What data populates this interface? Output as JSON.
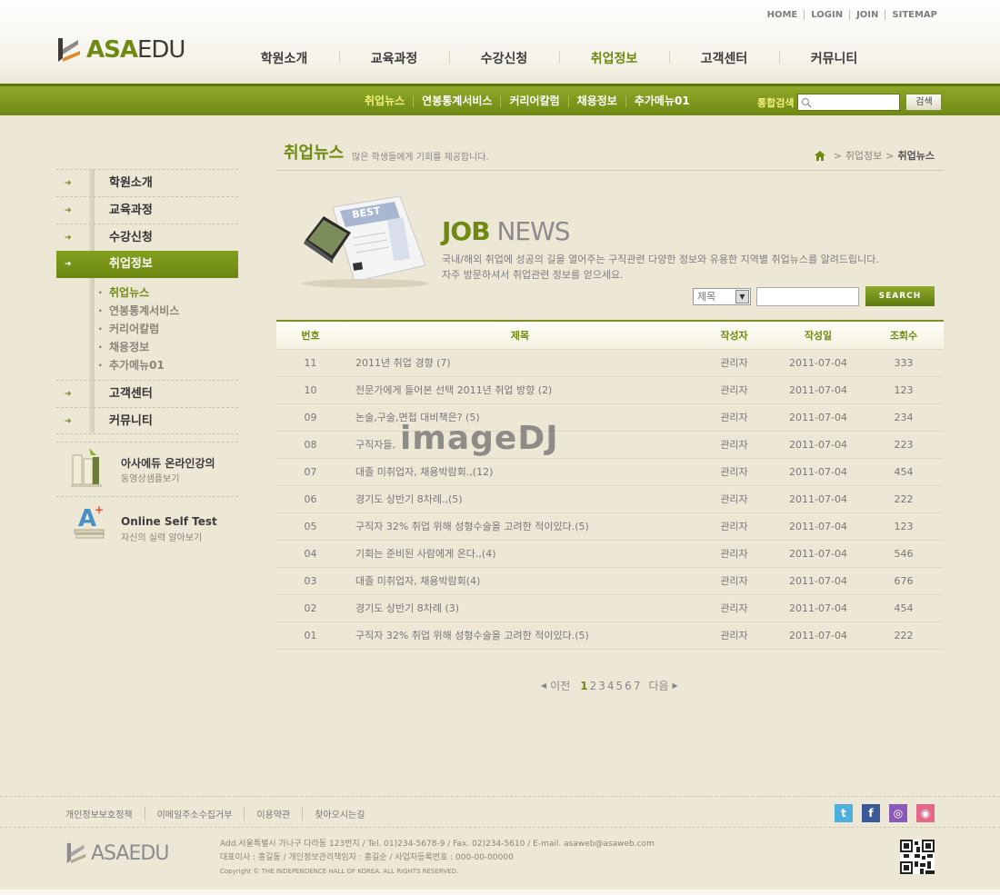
{
  "header": {
    "util": [
      "HOME",
      "LOGIN",
      "JOIN",
      "SITEMAP"
    ],
    "logo_a": "ASA",
    "logo_b": "EDU",
    "gnb": [
      "학원소개",
      "교육과정",
      "수강신청",
      "취업정보",
      "고객센터",
      "커뮤니티"
    ],
    "gnb_active": "취업정보"
  },
  "subnav": {
    "items": [
      "취업뉴스",
      "연봉통계서비스",
      "커리어칼럼",
      "채용정보",
      "추가메뉴01"
    ],
    "active": "취업뉴스",
    "search_label": "통합검색",
    "search_button": "검색"
  },
  "sidebar": {
    "items": [
      "학원소개",
      "교육과정",
      "수강신청",
      "취업정보",
      "고객센터",
      "커뮤니티"
    ],
    "active": "취업정보",
    "sub_items": [
      "취업뉴스",
      "연봉통계서비스",
      "커리어칼럼",
      "채용정보",
      "추가메뉴01"
    ],
    "sub_active": "취업뉴스",
    "banner1": {
      "title": "아사에듀 온라인강의",
      "subtitle": "동영상샘플보기"
    },
    "banner2": {
      "title": "Online Self Test",
      "subtitle": "자신의 실력 알아보기"
    }
  },
  "page": {
    "title": "취업뉴스",
    "desc": "많은 학생들에게 기회를 제공합니다.",
    "breadcrumb": [
      "취업정보",
      "취업뉴스"
    ],
    "hero_job": "JOB",
    "hero_news": "NEWS",
    "intro1": "국내/해외 취업에 성공의 길을 열어주는 구직관련 다양한 정보와 유용한 지역별 취업뉴스를 알려드립니다.",
    "intro2": "자주 방문하셔서 취업관련 정보를 얻으세요.",
    "search_select": "제목",
    "search_button": "SEARCH"
  },
  "table": {
    "headers": [
      "번호",
      "제목",
      "작성자",
      "작성일",
      "조회수"
    ],
    "rows": [
      {
        "no": "11",
        "title": "2011년 취업 경향 (7)",
        "author": "관리자",
        "date": "2011-07-04",
        "views": "333"
      },
      {
        "no": "10",
        "title": "전문가에게 들어본 선택 2011년 취업 방향 (2)",
        "author": "관리자",
        "date": "2011-07-04",
        "views": "123"
      },
      {
        "no": "09",
        "title": "논술,구술,면접 대비책은? (5)",
        "author": "관리자",
        "date": "2011-07-04",
        "views": "234"
      },
      {
        "no": "08",
        "title": "구직자들,",
        "author": "관리자",
        "date": "2011-07-04",
        "views": "223"
      },
      {
        "no": "07",
        "title": "대졸 미취업자, 채용박람회.,(12)",
        "author": "관리자",
        "date": "2011-07-04",
        "views": "454"
      },
      {
        "no": "06",
        "title": "경기도 상반기 8차례.,(5)",
        "author": "관리자",
        "date": "2011-07-04",
        "views": "222"
      },
      {
        "no": "05",
        "title": "구직자 32% 취업 위해 성형수술을 고려한 적이있다.(5)",
        "author": "관리자",
        "date": "2011-07-04",
        "views": "123"
      },
      {
        "no": "04",
        "title": "기회는 준비된 사람에게 온다.,(4)",
        "author": "관리자",
        "date": "2011-07-04",
        "views": "546"
      },
      {
        "no": "03",
        "title": "대졸 미취업자, 채용박람회(4)",
        "author": "관리자",
        "date": "2011-07-04",
        "views": "676"
      },
      {
        "no": "02",
        "title": "경기도 상반기 8차례 (3)",
        "author": "관리자",
        "date": "2011-07-04",
        "views": "454"
      },
      {
        "no": "01",
        "title": "구직자 32% 취업 위해 성형수술을 고려한 적이있다.(5)",
        "author": "관리자",
        "date": "2011-07-04",
        "views": "222"
      }
    ]
  },
  "paging": {
    "prev": "이전",
    "pages": [
      "1",
      "2",
      "3",
      "4",
      "5",
      "6",
      "7"
    ],
    "current": "1",
    "next": "다음"
  },
  "watermark": "imageDJ",
  "footer": {
    "links": [
      "개인정보보호정책",
      "이메일주소수집거부",
      "이용약관",
      "찾아오시는길"
    ],
    "address": "Add.서울특별시 가나구 다라동 123번지  / Tel. 01)234-5678-9  / Fax. 02)234-5610  / E-mail. asaweb@asaweb.com",
    "ceo": "대표이사 : 홍길동 / 개인정보관리책임자 : 홍길순 / 사업자등록번호 : 000-00-00000",
    "copyright": "Copyright © THE INDEPENDENCE HALL OF KOREA. ALL RIGHTS RESERVED.",
    "social": [
      "twitter-icon",
      "facebook-icon",
      "blog-icon",
      "me2day-icon"
    ]
  },
  "colors": {
    "brand": "#6e8a13",
    "background": "#ede8d6",
    "highlight": "#f3f07d"
  }
}
